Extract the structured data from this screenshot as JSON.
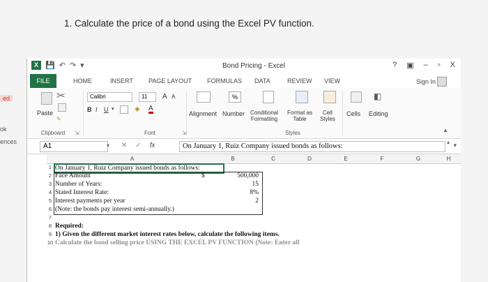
{
  "question": "1. Calculate the price of a bond using the Excel PV function.",
  "left_strip": {
    "item1": "ed",
    "item2": "ok",
    "item3": "ences"
  },
  "window": {
    "title": "Bond Pricing - Excel",
    "help": "?",
    "minimize": "–",
    "restore": "▫",
    "close": "X",
    "sign_in": "Sign In"
  },
  "tabs": [
    "FILE",
    "HOME",
    "INSERT",
    "PAGE LAYOUT",
    "FORMULAS",
    "DATA",
    "REVIEW",
    "VIEW"
  ],
  "ribbon": {
    "paste": "Paste",
    "clipboard": "Clipboard",
    "font_name": "Calibri",
    "font_size": "11",
    "grow": "A",
    "shrink": "A",
    "bold": "B",
    "italic": "I",
    "underline": "U",
    "font_color": "A",
    "font": "Font",
    "alignment": "Alignment",
    "number": "Number",
    "percent": "%",
    "cond_format": "Conditional",
    "cond_format2": "Formatting",
    "format_table": "Format as",
    "format_table2": "Table",
    "cell_styles": "Cell",
    "cell_styles2": "Styles",
    "styles": "Styles",
    "cells": "Cells",
    "editing": "Editing"
  },
  "formula_bar": {
    "name_box": "A1",
    "fx": "fx",
    "content": "On January 1, Ruiz Company issued bonds as follows:"
  },
  "columns": [
    "A",
    "B",
    "C",
    "D",
    "E",
    "F",
    "G",
    "H"
  ],
  "rows": [
    {
      "n": "1",
      "a": "On January 1, Ruiz Company issued bonds as follows:"
    },
    {
      "n": "2",
      "a": "Face Amount",
      "dollar": "$",
      "b": "500,000"
    },
    {
      "n": "3",
      "a": "Number of Years:",
      "b": "15"
    },
    {
      "n": "4",
      "a": "Stated Interest Rate:",
      "b": "8%"
    },
    {
      "n": "5",
      "a": "Interest payments per year",
      "b": "2"
    },
    {
      "n": "6",
      "a": "(Note: the bonds pay interest semi-annually.)"
    },
    {
      "n": "7",
      "a": ""
    },
    {
      "n": "8",
      "a": "Required:"
    },
    {
      "n": "9",
      "a": "1) Given the different market interest rates below, calculate the following items."
    },
    {
      "n": "10",
      "a": "Calculate the bond selling price USING THE EXCEL PV FUNCTION (Note: Enter all"
    }
  ]
}
